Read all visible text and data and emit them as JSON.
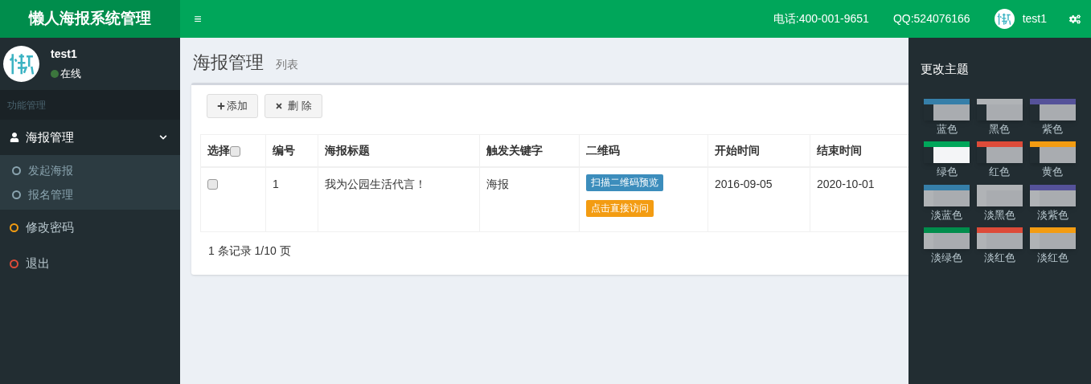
{
  "header": {
    "logo": "懒人海报系统管理",
    "menu_icon": "≡",
    "phone": "电话:400-001-9651",
    "qq": "QQ:524076166",
    "user": "test1"
  },
  "sidebar": {
    "user": {
      "name": "test1",
      "status": "在线",
      "online": true
    },
    "section": "功能管理",
    "items": [
      {
        "label": "海报管理",
        "kind": "user",
        "expanded": true,
        "children": [
          {
            "label": "发起海报",
            "color": "#8aa4af"
          },
          {
            "label": "报名管理",
            "color": "#8aa4af"
          }
        ]
      },
      {
        "label": "修改密码",
        "kind": "circle",
        "color": "#f39c12"
      },
      {
        "label": "退出",
        "kind": "circle",
        "color": "#dd4b39"
      }
    ]
  },
  "page": {
    "title": "海报管理",
    "subtitle": "列表"
  },
  "toolbar": [
    {
      "kind": "add",
      "label": "添加"
    },
    {
      "kind": "delete",
      "label": "删 除"
    }
  ],
  "table": {
    "columns": [
      "选择",
      "编号",
      "海报标题",
      "触发关键字",
      "二维码",
      "开始时间",
      "结束时间"
    ],
    "select_all_checked": false,
    "rows": [
      {
        "checked": false,
        "id": "1",
        "title": "我为公园生活代言！",
        "keyword": "海报",
        "qr_buttons": [
          {
            "label": "扫描二维码预览",
            "color": "#3c8dbc"
          },
          {
            "label": "点击直接访问",
            "color": "#f39c12"
          }
        ],
        "start": "2016-09-05",
        "end": "2020-10-01"
      }
    ]
  },
  "pager": "1 条记录 1/10 页",
  "theme_panel": {
    "title": "更改主题",
    "themes": [
      {
        "label": "蓝色",
        "color": "#367fa9",
        "kind": "dark",
        "selected": false
      },
      {
        "label": "黑色",
        "color": "#b0b3b6",
        "kind": "dark",
        "selected": false
      },
      {
        "label": "紫色",
        "color": "#555299",
        "kind": "dark",
        "selected": false
      },
      {
        "label": "绿色",
        "color": "#00a65a",
        "kind": "dark",
        "selected": true
      },
      {
        "label": "红色",
        "color": "#dd4b39",
        "kind": "dark",
        "selected": false
      },
      {
        "label": "黄色",
        "color": "#f39c12",
        "kind": "dark",
        "selected": false
      },
      {
        "label": "淡蓝色",
        "color": "#367fa9",
        "kind": "light",
        "selected": false
      },
      {
        "label": "淡黑色",
        "color": "#b0b3b6",
        "kind": "light",
        "selected": false
      },
      {
        "label": "淡紫色",
        "color": "#555299",
        "kind": "light",
        "selected": false
      },
      {
        "label": "淡绿色",
        "color": "#008d4c",
        "kind": "light",
        "selected": false
      },
      {
        "label": "淡红色",
        "color": "#dd4b39",
        "kind": "light",
        "selected": false
      },
      {
        "label": "淡红色",
        "color": "#f39c12",
        "kind": "light",
        "selected": false
      }
    ]
  }
}
